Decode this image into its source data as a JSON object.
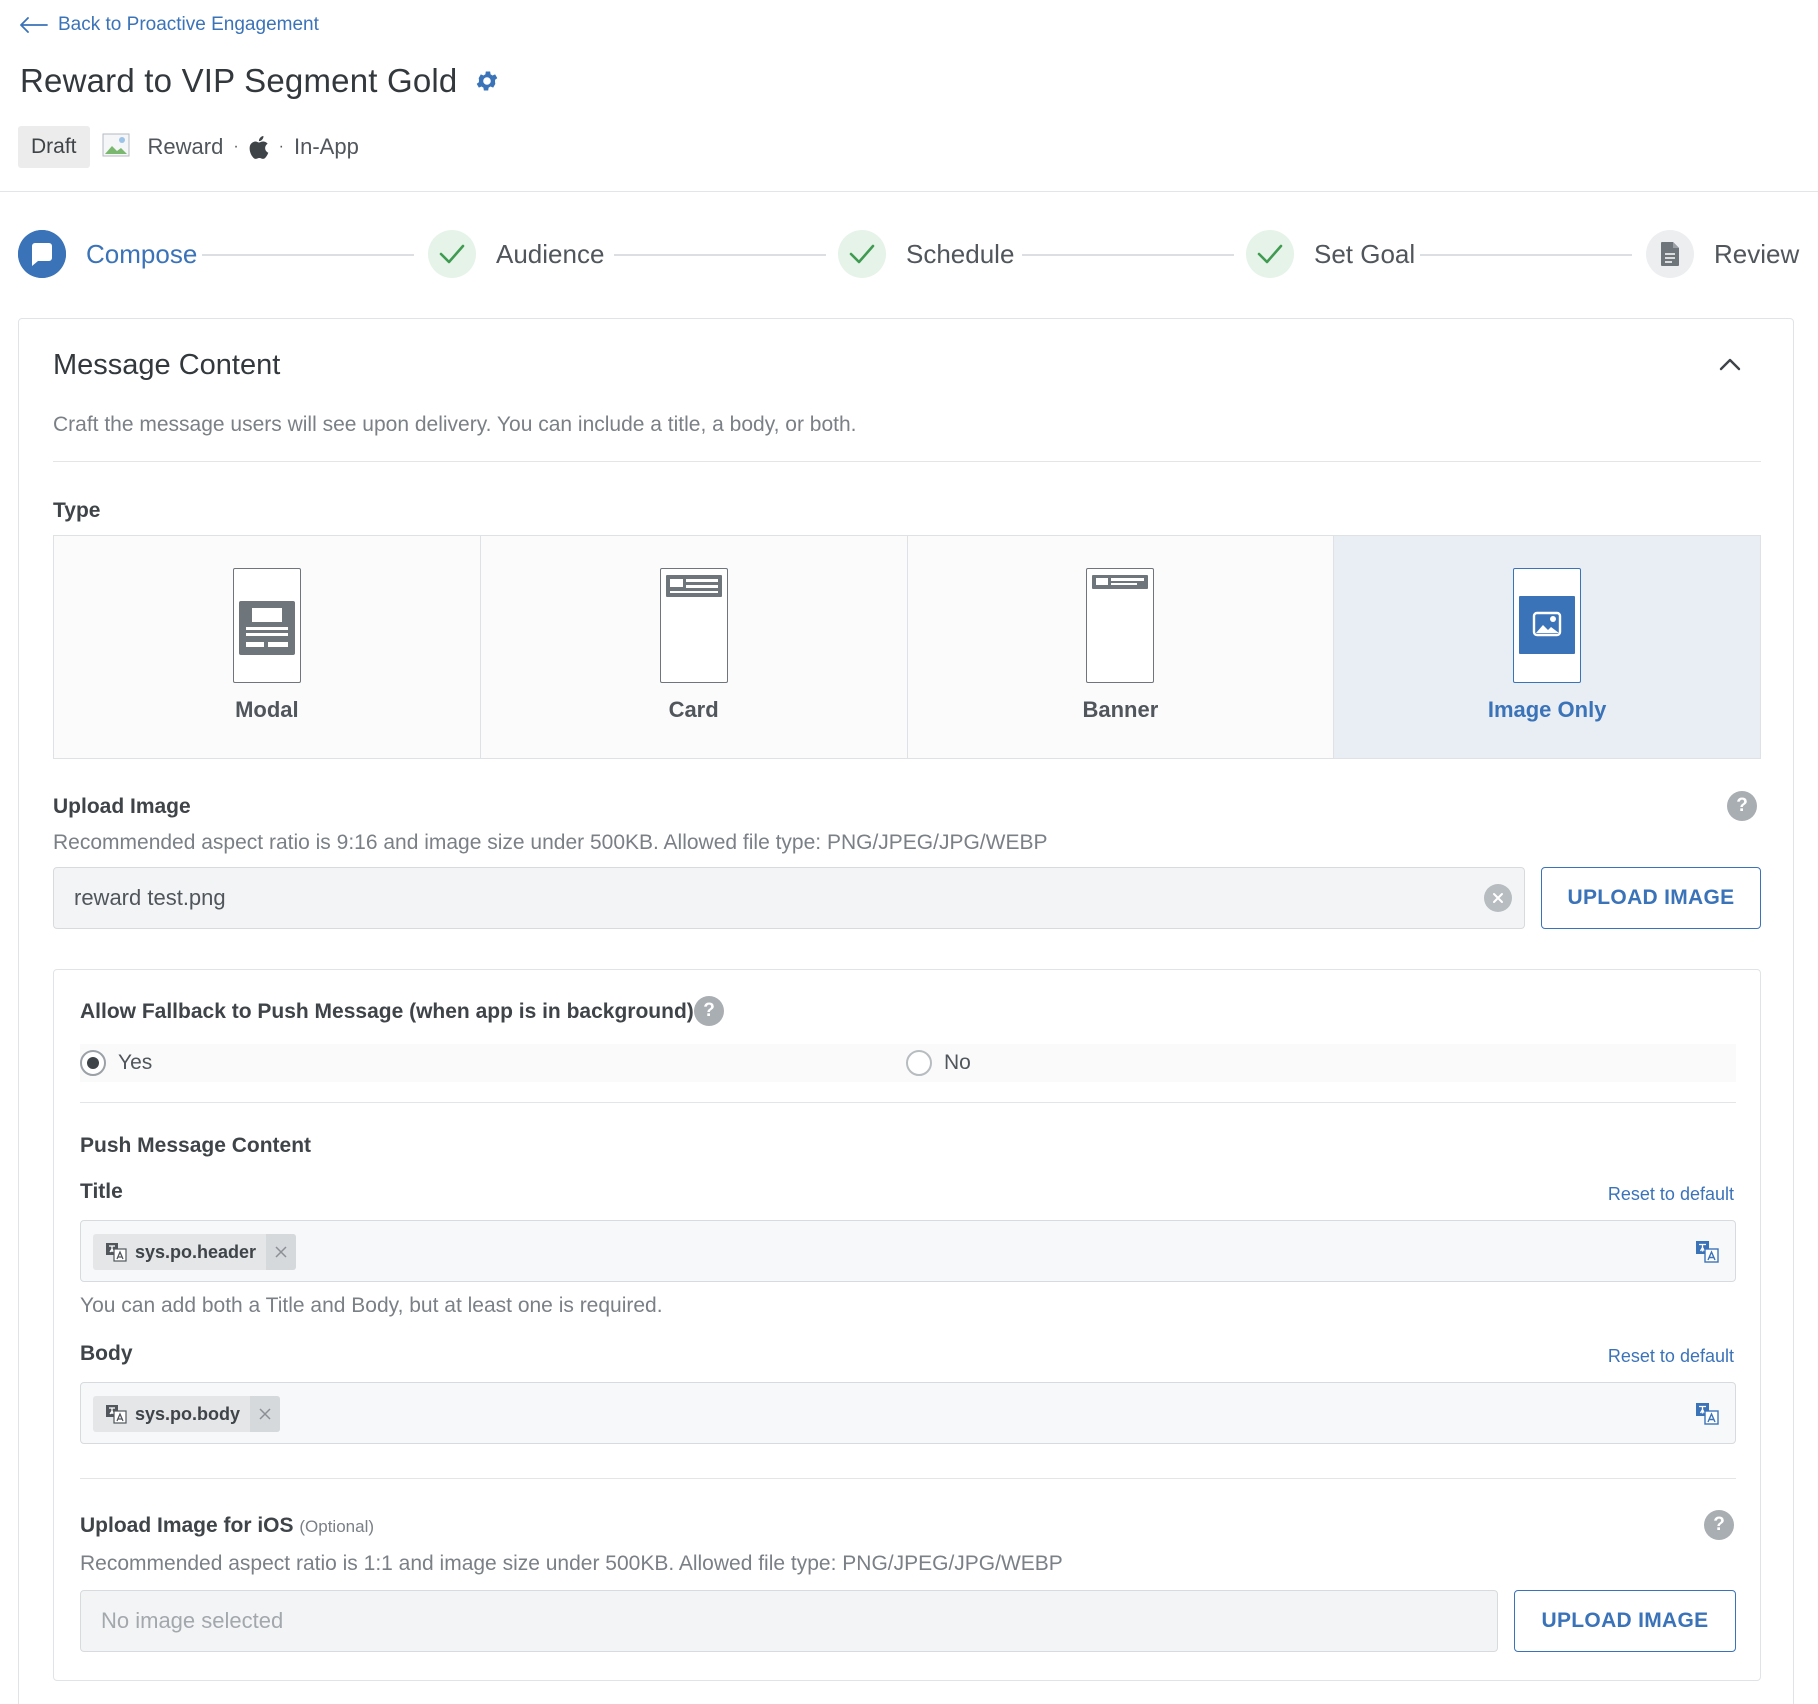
{
  "header": {
    "back_label": "Back to Proactive Engagement",
    "title": "Reward to VIP Segment Gold",
    "status": "Draft",
    "category": "Reward",
    "channel": "In-App",
    "separator": "·"
  },
  "stepper": {
    "steps": [
      {
        "label": "Compose",
        "state": "active"
      },
      {
        "label": "Audience",
        "state": "done"
      },
      {
        "label": "Schedule",
        "state": "done"
      },
      {
        "label": "Set Goal",
        "state": "done"
      },
      {
        "label": "Review",
        "state": "pending"
      }
    ]
  },
  "message_content": {
    "title": "Message Content",
    "description": "Craft the message users will see upon delivery. You can include a title, a body, or both.",
    "type_label": "Type",
    "types": [
      {
        "label": "Modal",
        "selected": false
      },
      {
        "label": "Card",
        "selected": false
      },
      {
        "label": "Banner",
        "selected": false
      },
      {
        "label": "Image Only",
        "selected": true
      }
    ],
    "upload": {
      "label": "Upload Image",
      "help": "Recommended aspect ratio is 9:16 and image size under 500KB. Allowed file type: PNG/JPEG/JPG/WEBP",
      "value": "reward test.png",
      "button": "UPLOAD IMAGE"
    },
    "fallback": {
      "label": "Allow Fallback to Push Message (when app is in background)",
      "options": [
        {
          "label": "Yes",
          "selected": true
        },
        {
          "label": "No",
          "selected": false
        }
      ]
    },
    "push": {
      "heading": "Push Message Content",
      "title_label": "Title",
      "title_token": "sys.po.header",
      "title_hint": "You can add both a Title and Body, but at least one is required.",
      "body_label": "Body",
      "body_token": "sys.po.body",
      "reset_label": "Reset to default"
    },
    "ios_upload": {
      "label": "Upload Image for iOS",
      "optional": "(Optional)",
      "help": "Recommended aspect ratio is 1:1 and image size under 500KB. Allowed file type: PNG/JPEG/JPG/WEBP",
      "placeholder": "No image selected",
      "button": "UPLOAD IMAGE"
    }
  },
  "colors": {
    "accent": "#3b73b9",
    "success": "#3f9b52",
    "selected_bg": "#e9eef4"
  }
}
